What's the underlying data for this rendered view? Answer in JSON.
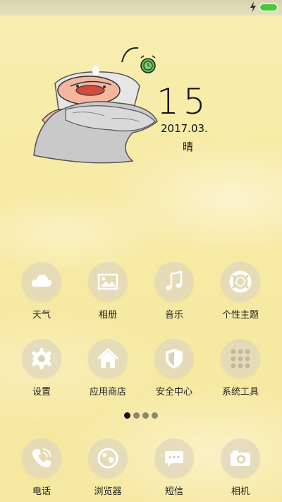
{
  "status_bar": {
    "battery_color": "#4cc63c",
    "charging_icon": "lightning-icon"
  },
  "clock_widget": {
    "day": "15",
    "date": "2017.03.",
    "weather": "晴"
  },
  "home_screen": {
    "apps": [
      {
        "label": "天气",
        "icon": "cloud-icon"
      },
      {
        "label": "相册",
        "icon": "picture-icon"
      },
      {
        "label": "音乐",
        "icon": "music-note-icon"
      },
      {
        "label": "个性主题",
        "icon": "lifebuoy-icon"
      },
      {
        "label": "设置",
        "icon": "gear-icon"
      },
      {
        "label": "应用商店",
        "icon": "house-icon"
      },
      {
        "label": "安全中心",
        "icon": "shield-icon"
      },
      {
        "label": "系统工具",
        "icon": "folder-grid-icon"
      }
    ],
    "page_indicator": {
      "pages": 4,
      "current": 1
    }
  },
  "dock": {
    "apps": [
      {
        "label": "电话",
        "icon": "phone-icon"
      },
      {
        "label": "浏览器",
        "icon": "globe-icon"
      },
      {
        "label": "短信",
        "icon": "message-icon"
      },
      {
        "label": "相机",
        "icon": "camera-icon"
      }
    ]
  }
}
